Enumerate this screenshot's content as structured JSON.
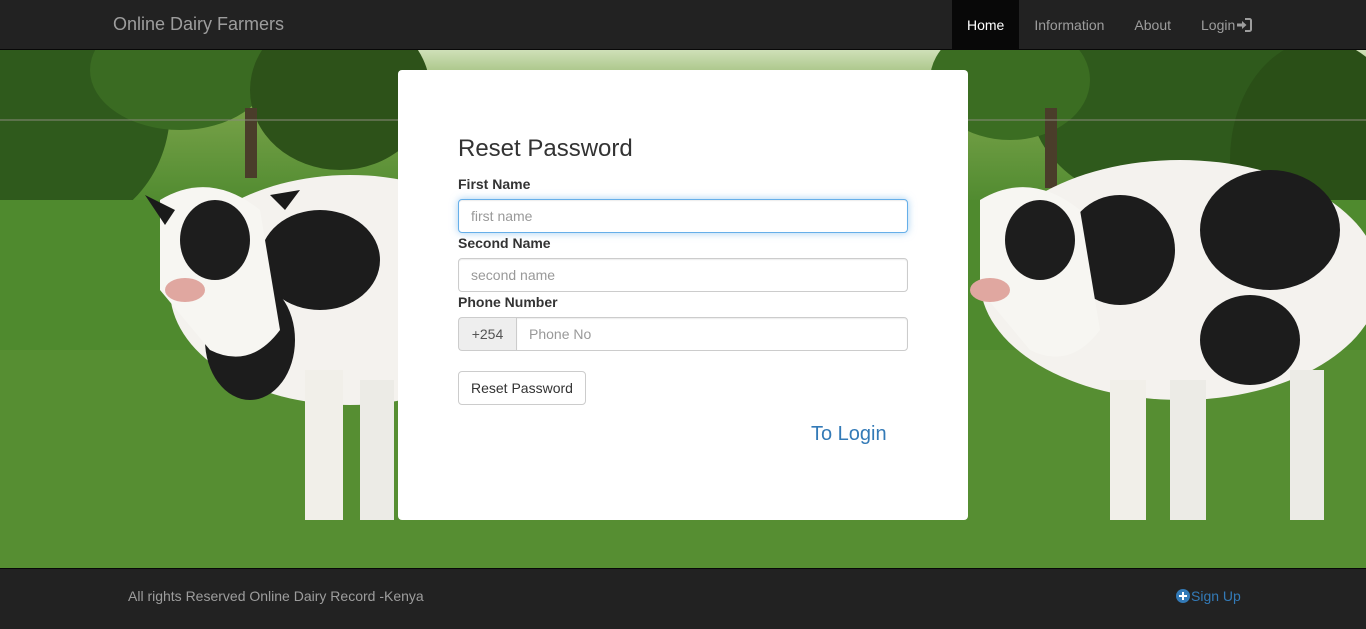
{
  "navbar": {
    "brand": "Online Dairy Farmers",
    "items": [
      {
        "label": "Home",
        "active": true
      },
      {
        "label": "Information",
        "active": false
      },
      {
        "label": "About",
        "active": false
      },
      {
        "label": "Login",
        "active": false,
        "icon": "log-in-icon"
      }
    ]
  },
  "form": {
    "title": "Reset Password",
    "first_name": {
      "label": "First Name",
      "placeholder": "first name",
      "value": ""
    },
    "second_name": {
      "label": "Second Name",
      "placeholder": "second name",
      "value": ""
    },
    "phone": {
      "label": "Phone Number",
      "prefix": "+254",
      "placeholder": "Phone No",
      "value": ""
    },
    "submit_label": "Reset Password",
    "to_login_label": "To Login"
  },
  "footer": {
    "text": "All rights Reserved Online Dairy Record -Kenya",
    "signup_label": "Sign Up",
    "signup_icon": "plus-circle-icon"
  },
  "colors": {
    "navbar_bg": "#222222",
    "nav_active_bg": "#080808",
    "link": "#337ab7",
    "focus_border": "#66afe9"
  }
}
